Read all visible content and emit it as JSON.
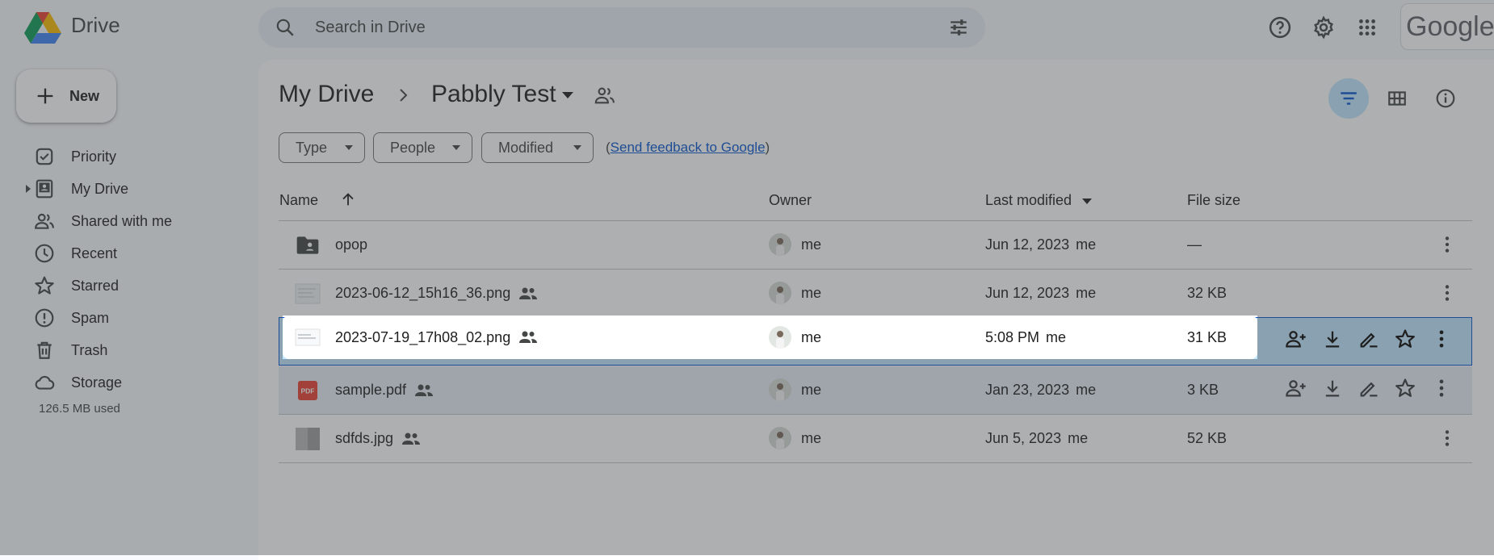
{
  "app": {
    "name": "Drive",
    "google_wordmark": "Google"
  },
  "search": {
    "placeholder": "Search in Drive"
  },
  "sidebar": {
    "new_label": "New",
    "items": [
      {
        "label": "Priority",
        "icon": "priority-icon"
      },
      {
        "label": "My Drive",
        "icon": "my-drive-icon"
      },
      {
        "label": "Shared with me",
        "icon": "shared-with-me-icon"
      },
      {
        "label": "Recent",
        "icon": "recent-icon"
      },
      {
        "label": "Starred",
        "icon": "star-icon"
      },
      {
        "label": "Spam",
        "icon": "spam-icon"
      },
      {
        "label": "Trash",
        "icon": "trash-icon"
      },
      {
        "label": "Storage",
        "icon": "cloud-icon"
      }
    ],
    "storage_used": "126.5 MB used"
  },
  "breadcrumb": {
    "root": "My Drive",
    "current": "Pabbly Test"
  },
  "filters": {
    "type": "Type",
    "people": "People",
    "modified": "Modified",
    "feedback_prefix": "(",
    "feedback_link": "Send feedback to Google",
    "feedback_suffix": ")"
  },
  "table": {
    "headers": {
      "name": "Name",
      "owner": "Owner",
      "last_modified": "Last modified",
      "file_size": "File size"
    },
    "rows": [
      {
        "name": "opop",
        "kind": "shared-folder",
        "shared": false,
        "owner": "me",
        "modified": "Jun 12, 2023",
        "modified_by": "me",
        "size": "—"
      },
      {
        "name": "2023-06-12_15h16_36.png",
        "kind": "image",
        "shared": true,
        "owner": "me",
        "modified": "Jun 12, 2023",
        "modified_by": "me",
        "size": "32 KB"
      },
      {
        "name": "2023-07-19_17h08_02.png",
        "kind": "image",
        "shared": true,
        "owner": "me",
        "modified": "5:08 PM",
        "modified_by": "me",
        "size": "31 KB"
      },
      {
        "name": "sample.pdf",
        "kind": "pdf",
        "shared": true,
        "owner": "me",
        "modified": "Jan 23, 2023",
        "modified_by": "me",
        "size": "3 KB"
      },
      {
        "name": "sdfds.jpg",
        "kind": "image",
        "shared": true,
        "owner": "me",
        "modified": "Jun 5, 2023",
        "modified_by": "me",
        "size": "52 KB"
      }
    ],
    "pdf_badge": "PDF"
  },
  "colors": {
    "accent": "#0b57d0",
    "selected_row": "#c2e7ff",
    "surface": "#f8fafd",
    "overlay": "#3c4043"
  }
}
